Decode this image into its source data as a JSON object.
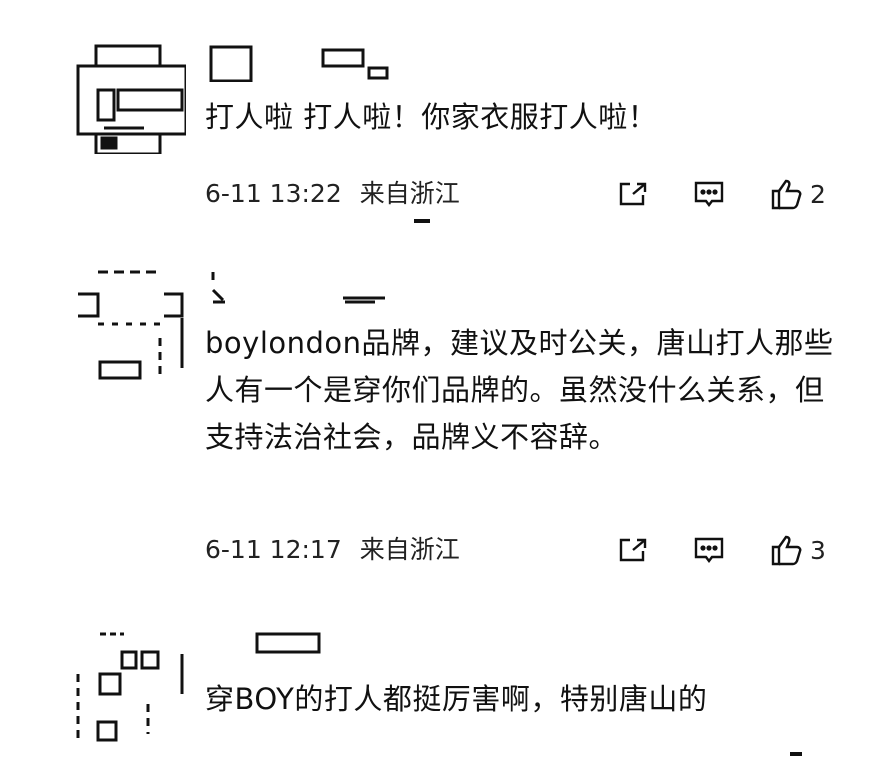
{
  "comments": [
    {
      "text": "打人啦 打人啦！你家衣服打人啦！",
      "time": "6-11 13:22",
      "location": "来自浙江",
      "likes": "2",
      "icons": [
        "share-icon",
        "reply-icon",
        "like-icon"
      ]
    },
    {
      "text": "boylondon品牌，建议及时公关，唐山打人那些人有一个是穿你们品牌的。虽然没什么关系，但支持法治社会，品牌义不容辞。",
      "time": "6-11 12:17",
      "location": "来自浙江",
      "likes": "3",
      "icons": [
        "share-icon",
        "reply-icon",
        "like-icon"
      ]
    },
    {
      "text": "穿BOY的打人都挺厉害啊，特别唐山的",
      "time": "",
      "location": "",
      "likes": "",
      "icons": []
    }
  ]
}
